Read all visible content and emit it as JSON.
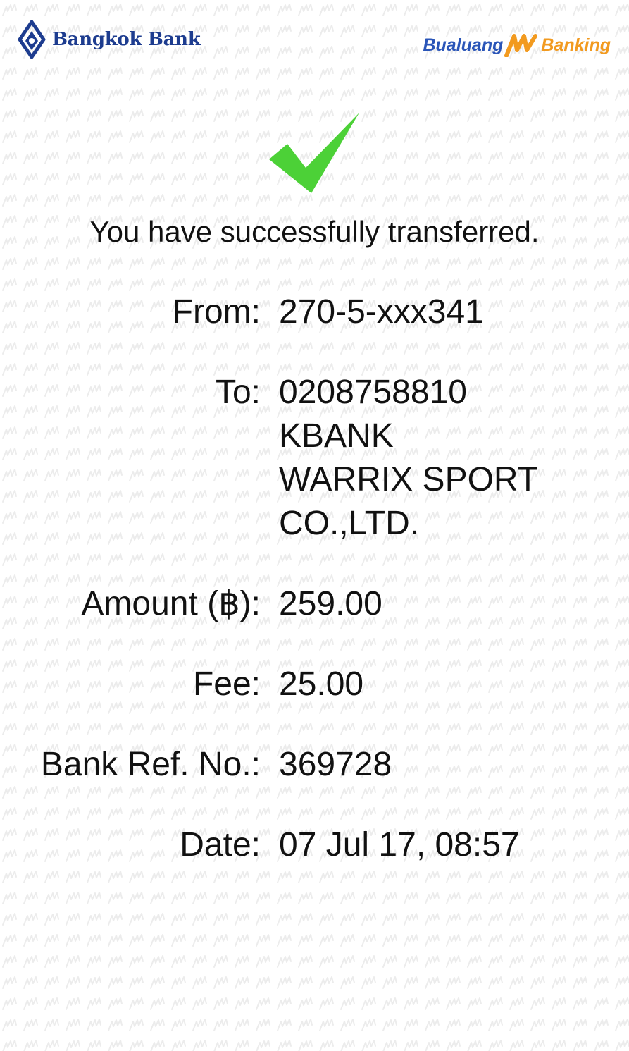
{
  "header": {
    "bank_name": "Bangkok Bank",
    "app_brand_left": "Bualuang",
    "app_brand_right": "Banking",
    "brand_color": "#1d3c8f",
    "accent_color": "#f29a1f"
  },
  "status": {
    "icon": "check-icon",
    "icon_color": "#4cd137",
    "message": "You have successfully transferred."
  },
  "transfer": {
    "from_label": "From:",
    "from_value": "270-5-xxx341",
    "to_label": "To:",
    "to_account": "0208758810",
    "to_bank": "KBANK",
    "to_name_line1": "WARRIX SPORT",
    "to_name_line2": "CO.,LTD.",
    "amount_label": "Amount (฿):",
    "amount_value": "259.00",
    "fee_label": "Fee:",
    "fee_value": "25.00",
    "ref_label": "Bank Ref. No.:",
    "ref_value": "369728",
    "date_label": "Date:",
    "date_value": "07 Jul 17, 08:57"
  }
}
